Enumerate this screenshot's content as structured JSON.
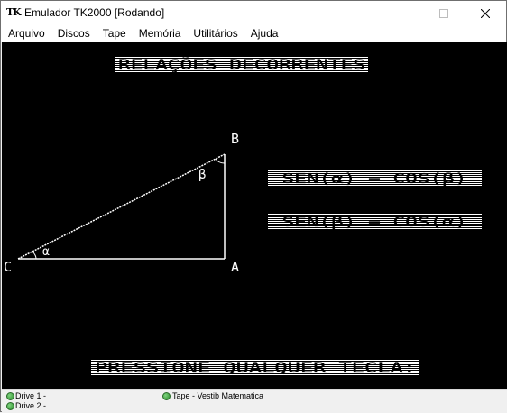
{
  "window": {
    "app_icon_text": "TK",
    "title": "Emulador TK2000 [Rodando]"
  },
  "menu": {
    "items": [
      "Arquivo",
      "Discos",
      "Tape",
      "Memória",
      "Utilitários",
      "Ajuda"
    ]
  },
  "screen": {
    "heading": "RELAÇÕES DECORRENTES",
    "vertex_b": "B",
    "vertex_a": "A",
    "vertex_c": "C",
    "angle_beta": "β",
    "angle_alpha": "α",
    "relation_1": "SEN(α) = COS(β)",
    "relation_2": "SEN(β) = COS(α)",
    "prompt": "PRESSIONE QUALQUER TECLA:",
    "colors": {
      "background": "#000000",
      "foreground": "#ffffff"
    }
  },
  "status": {
    "drive1": "Drive 1 -",
    "drive2": "Drive 2 -",
    "tape": "Tape - Vestib Matematica"
  }
}
